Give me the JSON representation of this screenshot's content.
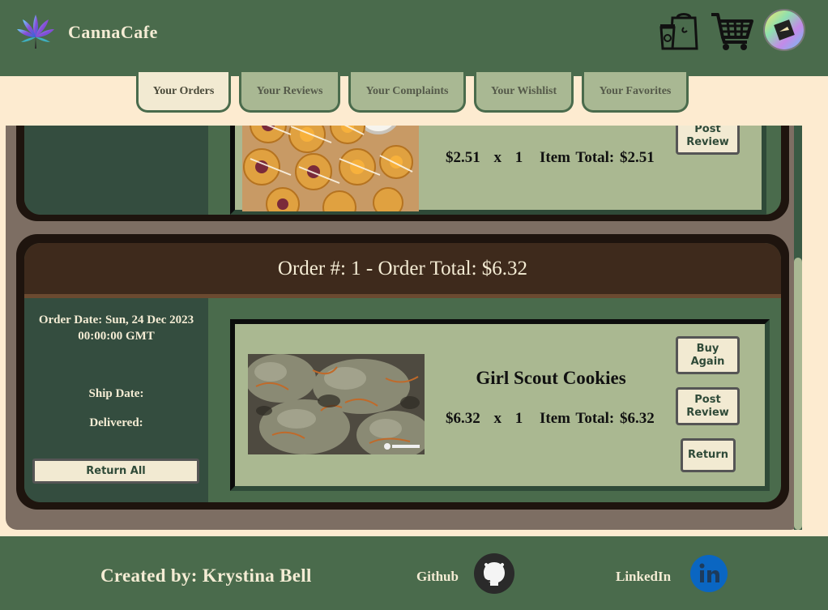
{
  "header": {
    "brand": "CannaCafe",
    "icons": [
      "cannabis-leaf-logo-icon",
      "takeout-orders-icon",
      "shopping-cart-icon",
      "user-avatar"
    ]
  },
  "tabs": [
    {
      "label": "Your Orders",
      "active": true
    },
    {
      "label": "Your Reviews",
      "active": false
    },
    {
      "label": "Your Complaints",
      "active": false
    },
    {
      "label": "Your Wishlist",
      "active": false
    },
    {
      "label": "Your Favorites",
      "active": false
    }
  ],
  "orders": [
    {
      "item": {
        "price": "$2.51",
        "times": "x",
        "qty": "1",
        "total_label": "Item Total: $2.51",
        "post_review": "Post Review"
      }
    },
    {
      "header": "Order #: 1 - Order Total: $6.32",
      "order_date": "Order Date: Sun, 24 Dec 2023 00:00:00 GMT",
      "ship_date": "Ship Date:",
      "delivered": "Delivered:",
      "return_all": "Return All",
      "item": {
        "name": "Girl Scout Cookies",
        "price": "$6.32",
        "times": "x",
        "qty": "1",
        "total_label": "Item Total: $6.32",
        "buy_again": "Buy Again",
        "post_review": "Post Review",
        "return": "Return"
      }
    }
  ],
  "footer": {
    "credit": "Created by: Krystina Bell",
    "github": "Github",
    "linkedin": "LinkedIn"
  },
  "colors": {
    "header_green": "#4a6b4c",
    "cream": "#fdebd0",
    "card_sage": "#aab891",
    "order_brown": "#3e2a1c"
  }
}
